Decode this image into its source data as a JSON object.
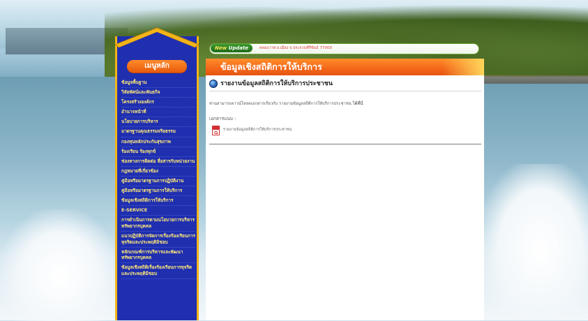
{
  "colors": {
    "sidebar_bg": "#1f2fb0",
    "sidebar_border": "#f2b41a",
    "menu_header": "#f06a1a",
    "menu_text": "#ffe97a",
    "title_bar": "#f46618",
    "update_green": "#2f8a24"
  },
  "update": {
    "tag_new": "New",
    "tag_update": "Update",
    "text": "คลองวาฬ อ.เมือง จ.ประจวบคีรีขันธ์ 77000"
  },
  "sidebar": {
    "header": "เมนูหลัก",
    "items": [
      "ข้อมูลพื้นฐาน",
      "วิสัยทัศน์และพันธกิจ",
      "โครงสร้างองค์กร",
      "อำนาจหน้าที่",
      "นโยบายการบริหาร",
      "มาตรฐานคุณธรรมจริยธรรม",
      "กองทุนหลักประกันสุขภาพ",
      "ร้องเรียน ร้องทุกข์",
      "ช่องทางการติดต่อ สื่อสารกับหน่วยงาน",
      "กฎหมายที่เกี่ยวข้อง",
      "คู่มือหรือมาตรฐานการปฏิบัติงาน",
      "คู่มือหรือมาตรฐานการให้บริการ",
      "ข้อมูลเชิงสถิติการให้บริการ",
      "E-SERVICE",
      "การดำเนินการตามนโยบายการบริหารทรัพยากรบุคคล",
      "แนวปฏิบัติการจัดการเรื่องร้องเรียนการทุจริตและประพฤติมิชอบ",
      "หลักเกณฑ์การบริหารและพัฒนาทรัพยากรบุคคล",
      "ข้อมูลเชิงสถิติเรื่องร้องเรียนการทุจริตและประพฤติมิชอบ"
    ]
  },
  "main": {
    "title": "ข้อมูลเชิงสถิติการให้บริการ",
    "section_title": "รายงานข้อมูลสถิติการให้บริการประชาชน",
    "description": "ท่านสามารถดาวน์โหลดเอกสารเกี่ยวกับ รายงานข้อมูลสถิติการให้บริการประชาชน",
    "description_tail": "ได้ที่นี่",
    "attachments_label": "เอกสารแนบ :",
    "attachments": [
      {
        "name": "รายงานข้อมูลสถิติการให้บริการประชาชน",
        "icon": "pdf-icon"
      }
    ]
  }
}
